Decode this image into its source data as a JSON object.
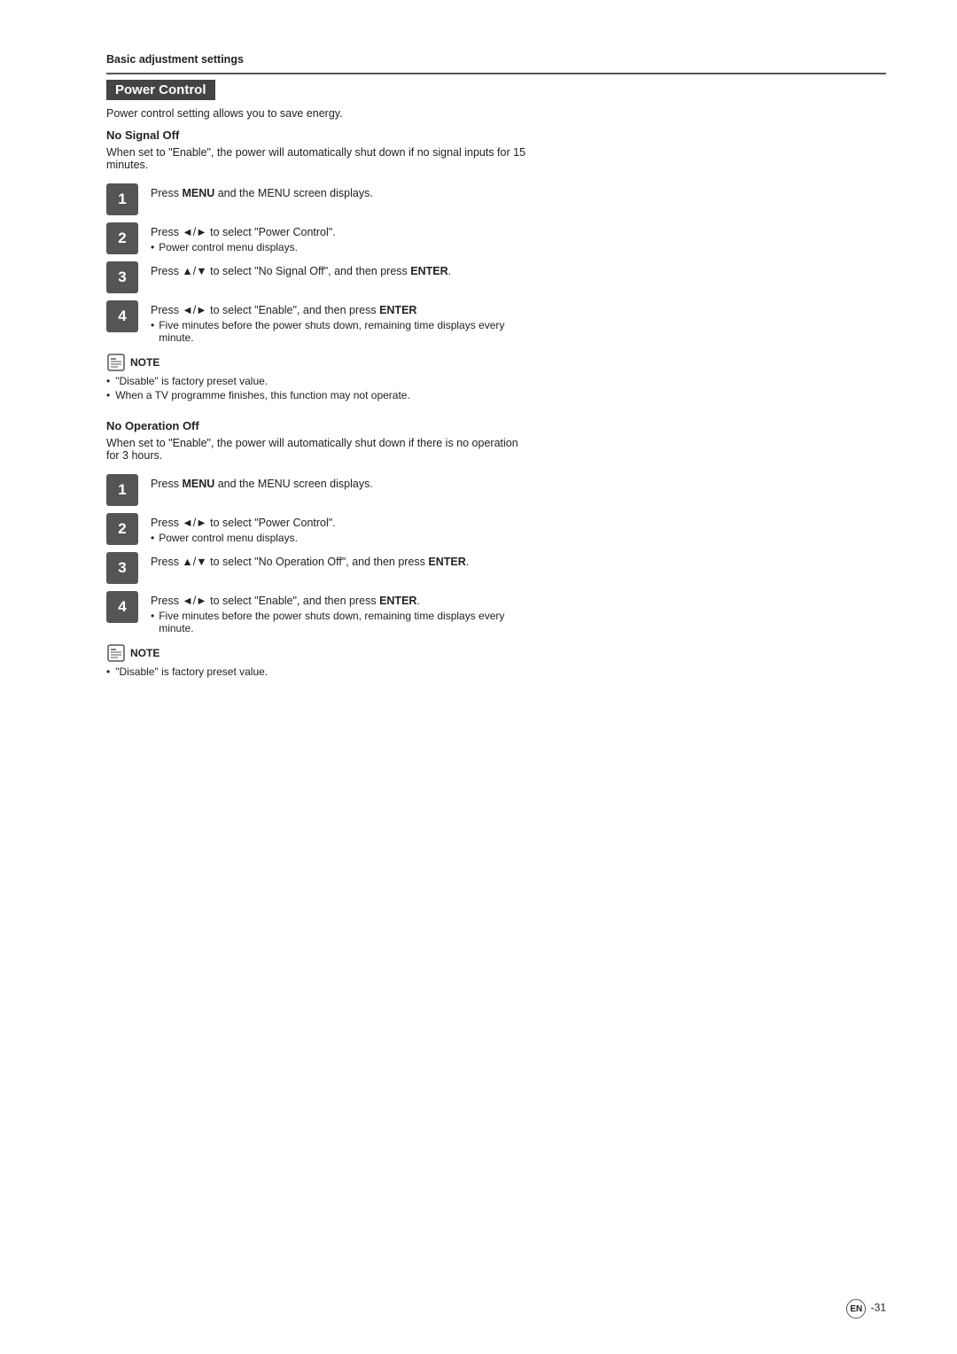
{
  "page": {
    "section_header": "Basic adjustment settings",
    "title": "Power Control",
    "intro": "Power control setting allows you to save energy.",
    "no_signal_off": {
      "title": "No Signal Off",
      "description": "When set to \"Enable\", the power will automatically shut down if no signal inputs for 15 minutes.",
      "steps": [
        {
          "number": "1",
          "text": "Press MENU and the MENU screen displays.",
          "bold_word": "MENU",
          "bullets": []
        },
        {
          "number": "2",
          "text": "Press ◄/► to select \"Power Control\".",
          "bullets": [
            "Power control menu displays."
          ]
        },
        {
          "number": "3",
          "text": "Press ▲/▼ to select \"No Signal Off\", and then press ENTER.",
          "bold_words": [
            "ENTER"
          ],
          "bullets": []
        },
        {
          "number": "4",
          "text": "Press ◄/► to select \"Enable\", and then press ENTER",
          "bold_words": [
            "ENTER"
          ],
          "bullets": [
            "Five minutes before the power shuts down, remaining time displays every minute."
          ]
        }
      ],
      "notes": [
        "\"Disable\" is factory preset value.",
        "When a TV programme finishes, this function may not operate."
      ]
    },
    "no_operation_off": {
      "title": "No Operation Off",
      "description": "When set to \"Enable\", the power will automatically shut down if there is no operation for 3 hours.",
      "steps": [
        {
          "number": "1",
          "text": "Press MENU and the MENU screen displays.",
          "bold_word": "MENU",
          "bullets": []
        },
        {
          "number": "2",
          "text": "Press ◄/► to select \"Power Control\".",
          "bullets": [
            "Power control menu displays."
          ]
        },
        {
          "number": "3",
          "text": "Press ▲/▼ to select \"No Operation Off\", and then press ENTER.",
          "bold_words": [
            "ENTER"
          ],
          "bullets": []
        },
        {
          "number": "4",
          "text": "Press ◄/► to select \"Enable\", and then press ENTER.",
          "bold_words": [
            "ENTER"
          ],
          "bullets": [
            "Five minutes before the power shuts down, remaining time displays every minute."
          ]
        }
      ],
      "notes": [
        "\"Disable\" is factory preset value."
      ]
    },
    "page_number": "-31"
  }
}
